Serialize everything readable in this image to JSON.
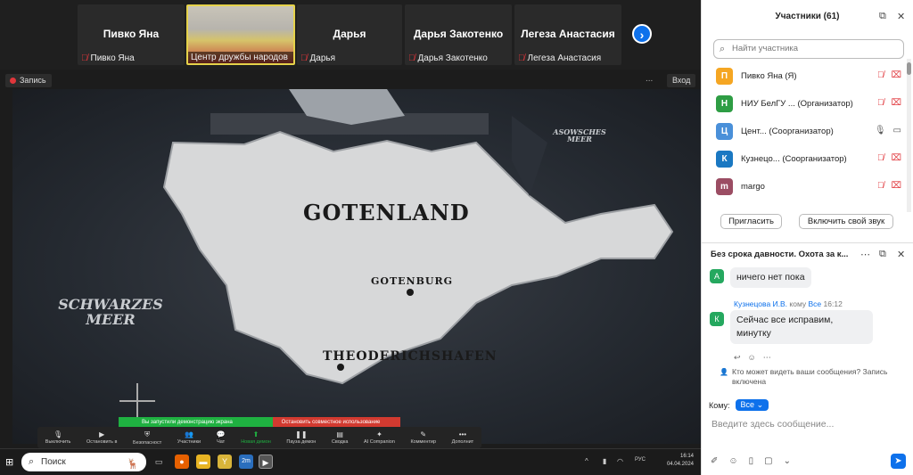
{
  "strip": {
    "tiles": [
      {
        "name": "Пивко Яна",
        "sub": "Пивко Яна"
      },
      {
        "name": "",
        "sub": "Центр дружбы народов"
      },
      {
        "name": "Дарья",
        "sub": "Дарья"
      },
      {
        "name": "Дарья Закотенко",
        "sub": "Дарья Закотенко"
      },
      {
        "name": "Легеза Анастасия",
        "sub": "Легеза Анастасия"
      }
    ],
    "next_icon": "chevron-right-icon"
  },
  "meeting": {
    "recording_label": "Запись",
    "enter_label": "Вход",
    "top_dots": "..."
  },
  "map": {
    "main_label": "GOTENLAND",
    "city1": "GOTENBURG",
    "city2": "THEODERICHSHAFEN",
    "sea_left": "SCHWARZES MEER",
    "sea_left_line1": "SCHWARZES",
    "sea_left_line2": "MEER",
    "sea_right_line1": "ASOWSCHES",
    "sea_right_line2": "MEER"
  },
  "share_bar": {
    "green_text": "Вы запустили демонстрацию экрана",
    "red_text": "Остановить совместное использование"
  },
  "toolbar": {
    "items": [
      {
        "label": "Выключить",
        "icon": "microphone-icon"
      },
      {
        "label": "Остановить в",
        "icon": "video-camera-icon"
      },
      {
        "label": "Безопасност",
        "icon": "shield-icon"
      },
      {
        "label": "Участники",
        "icon": "people-icon",
        "count": "61"
      },
      {
        "label": "Чат",
        "icon": "chat-icon",
        "count": "37"
      },
      {
        "label": "Новая демон",
        "icon": "share-screen-icon"
      },
      {
        "label": "Паузa демон",
        "icon": "pause-icon"
      },
      {
        "label": "Сводка",
        "icon": "summary-icon"
      },
      {
        "label": "AI Companion",
        "icon": "sparkle-icon"
      },
      {
        "label": "Комментир",
        "icon": "pen-icon"
      },
      {
        "label": "Дополнит",
        "icon": "more-icon"
      }
    ]
  },
  "taskbar": {
    "search_placeholder": "Поиск",
    "lang": "РУС",
    "time": "16:14",
    "date": "04.04.2024"
  },
  "participants": {
    "title": "Участники (61)",
    "search_placeholder": "Найти участника",
    "list": [
      {
        "initial": "П",
        "color": "#f5a623",
        "name": "Пивко Яна (Я)"
      },
      {
        "initial": "Н",
        "color": "#2e9d44",
        "name": "НИУ БелГУ ... (Организатор)"
      },
      {
        "initial": "Ц",
        "color": "#4a90d9",
        "name": "Цент...  (Соорганизатор)"
      },
      {
        "initial": "К",
        "color": "#1a78c2",
        "name": "Кузнецо...  (Соорганизатор)"
      },
      {
        "initial": "m",
        "color": "#9b4d63",
        "name": "margo"
      }
    ],
    "invite_button": "Пригласить",
    "unmute_button": "Включить свой звук"
  },
  "chat": {
    "title": "Без срока давности. Охота за к...",
    "msg1": {
      "initial": "А",
      "text": "ничего нет пока"
    },
    "meta2": {
      "sender": "Кузнецова И.В.",
      "to_word": "кому",
      "to": "Все",
      "time": "16:12"
    },
    "msg2": {
      "initial": "К",
      "text_line1": "Сейчас все исправим,",
      "text_line2": "минутку"
    },
    "note": "Кто может видеть ваши сообщения? Запись включена",
    "to_label": "Кому:",
    "to_value": "Все",
    "input_placeholder": "Введите здесь сообщение..."
  }
}
